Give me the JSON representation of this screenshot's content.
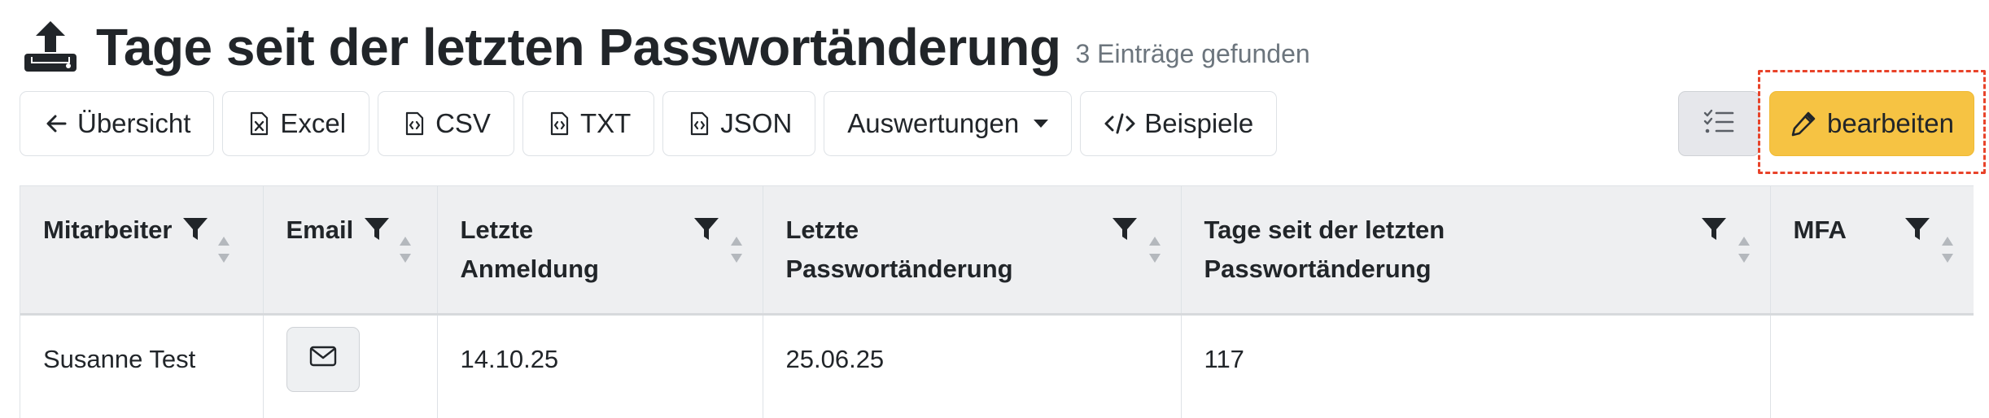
{
  "header": {
    "title": "Tage seit der letzten Passwortänderung",
    "count": "3 Einträge gefunden",
    "icon": "upload-icon"
  },
  "toolbar": {
    "overview": "Übersicht",
    "excel": "Excel",
    "csv": "CSV",
    "txt": "TXT",
    "json": "JSON",
    "reports": "Auswertungen",
    "examples": "Beispiele",
    "edit": "bearbeiten"
  },
  "colors": {
    "edit_button": "#f6c343",
    "highlight": "#e8432a",
    "muted_text": "#6c757d"
  },
  "table": {
    "columns": [
      {
        "line1": "Mitarbeiter",
        "line2": ""
      },
      {
        "line1": "Email",
        "line2": ""
      },
      {
        "line1": "Letzte",
        "line2": "Anmeldung"
      },
      {
        "line1": "Letzte",
        "line2": "Passwortänderung"
      },
      {
        "line1": "Tage seit der letzten",
        "line2": "Passwortänderung"
      },
      {
        "line1": "MFA",
        "line2": ""
      }
    ],
    "rows": [
      {
        "employee": "Susanne Test",
        "email_icon": "envelope-icon",
        "last_login": "14.10.25",
        "last_pw_change": "25.06.25",
        "days": "117",
        "mfa": ""
      }
    ]
  }
}
